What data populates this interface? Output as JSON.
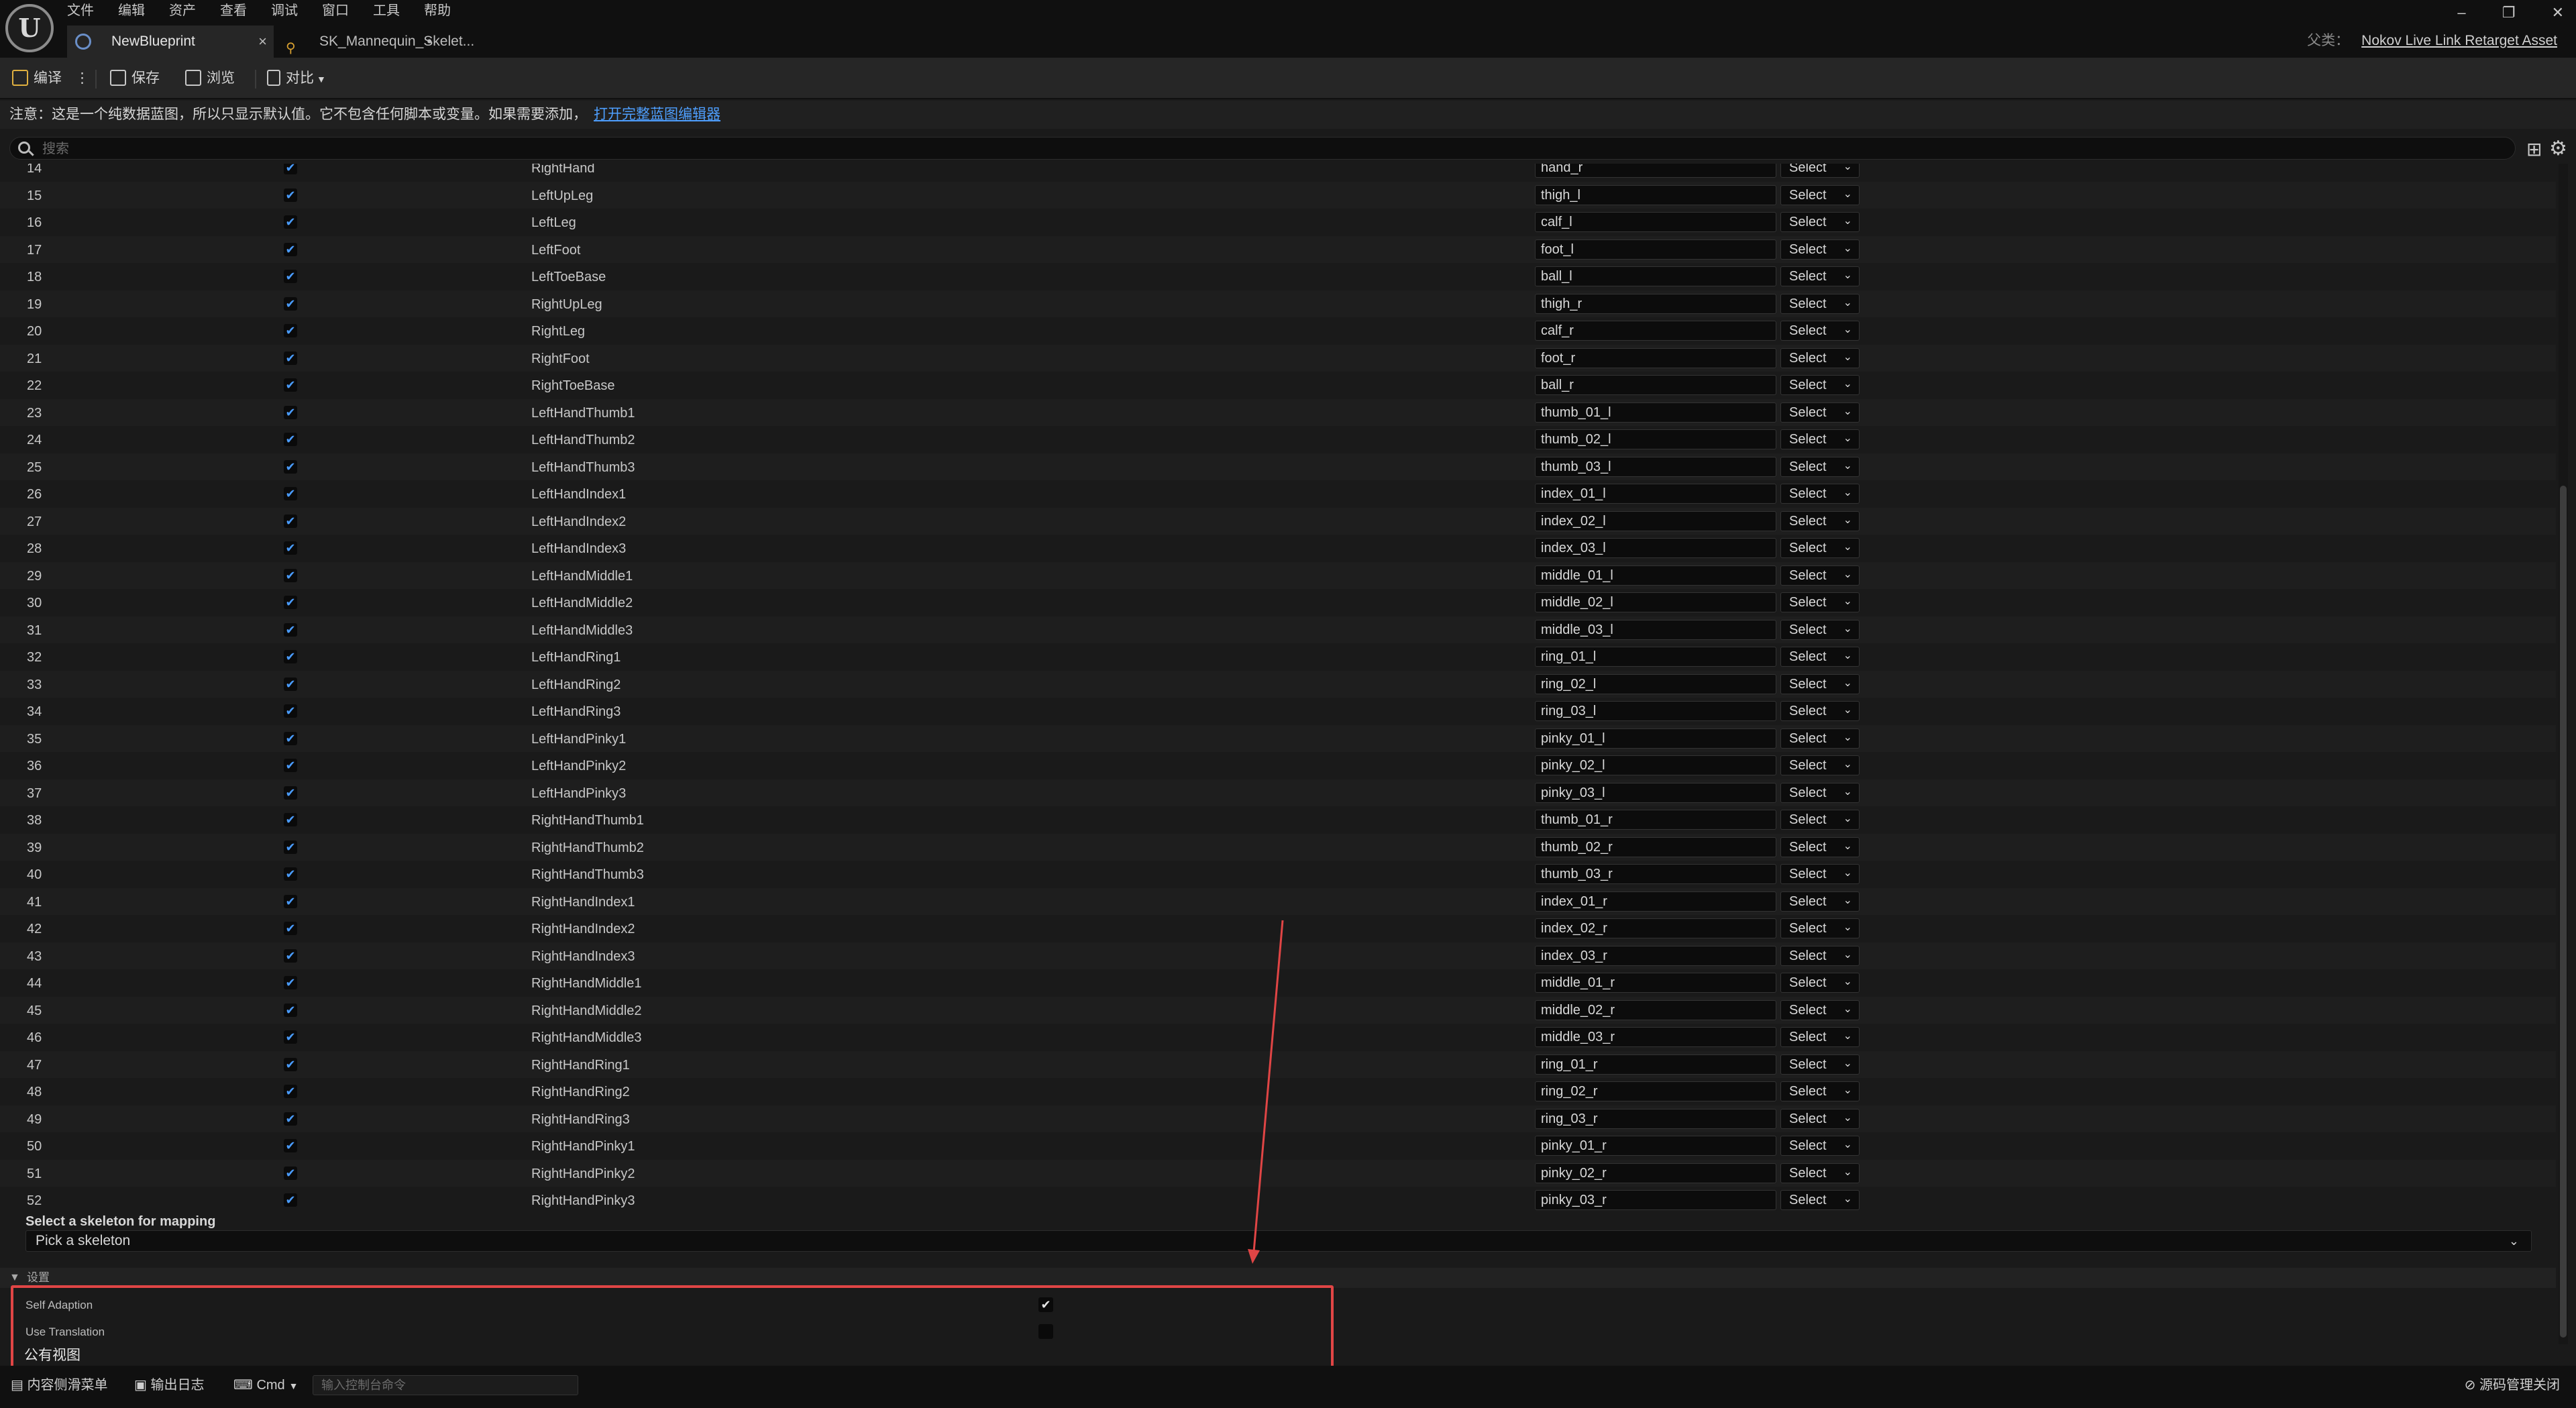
{
  "menu": [
    "文件",
    "编辑",
    "资产",
    "查看",
    "调试",
    "窗口",
    "工具",
    "帮助"
  ],
  "tabs": [
    {
      "label": "NewBlueprint",
      "close": "×"
    },
    {
      "label": "SK_Mannequin_Skelet...",
      "close": "•"
    }
  ],
  "window_controls": {
    "minimize": "–",
    "restore": "❐",
    "close": "✕"
  },
  "parent": {
    "label": "父类：",
    "value": "Nokov Live Link Retarget Asset"
  },
  "toolbar": {
    "compile": "编译",
    "more": "⋮",
    "save": "保存",
    "browse": "浏览",
    "diff": "对比"
  },
  "notice": {
    "text": "注意：这是一个纯数据蓝图，所以只显示默认值。它不包含任何脚本或变量。如果需要添加，",
    "link": "打开完整蓝图编辑器"
  },
  "search": {
    "placeholder": "搜索"
  },
  "rows": [
    {
      "index": "14",
      "name": "RightHand",
      "bone": "hand_r",
      "select": "Select"
    },
    {
      "index": "15",
      "name": "LeftUpLeg",
      "bone": "thigh_l",
      "select": "Select"
    },
    {
      "index": "16",
      "name": "LeftLeg",
      "bone": "calf_l",
      "select": "Select"
    },
    {
      "index": "17",
      "name": "LeftFoot",
      "bone": "foot_l",
      "select": "Select"
    },
    {
      "index": "18",
      "name": "LeftToeBase",
      "bone": "ball_l",
      "select": "Select"
    },
    {
      "index": "19",
      "name": "RightUpLeg",
      "bone": "thigh_r",
      "select": "Select"
    },
    {
      "index": "20",
      "name": "RightLeg",
      "bone": "calf_r",
      "select": "Select"
    },
    {
      "index": "21",
      "name": "RightFoot",
      "bone": "foot_r",
      "select": "Select"
    },
    {
      "index": "22",
      "name": "RightToeBase",
      "bone": "ball_r",
      "select": "Select"
    },
    {
      "index": "23",
      "name": "LeftHandThumb1",
      "bone": "thumb_01_l",
      "select": "Select"
    },
    {
      "index": "24",
      "name": "LeftHandThumb2",
      "bone": "thumb_02_l",
      "select": "Select"
    },
    {
      "index": "25",
      "name": "LeftHandThumb3",
      "bone": "thumb_03_l",
      "select": "Select"
    },
    {
      "index": "26",
      "name": "LeftHandIndex1",
      "bone": "index_01_l",
      "select": "Select"
    },
    {
      "index": "27",
      "name": "LeftHandIndex2",
      "bone": "index_02_l",
      "select": "Select"
    },
    {
      "index": "28",
      "name": "LeftHandIndex3",
      "bone": "index_03_l",
      "select": "Select"
    },
    {
      "index": "29",
      "name": "LeftHandMiddle1",
      "bone": "middle_01_l",
      "select": "Select"
    },
    {
      "index": "30",
      "name": "LeftHandMiddle2",
      "bone": "middle_02_l",
      "select": "Select"
    },
    {
      "index": "31",
      "name": "LeftHandMiddle3",
      "bone": "middle_03_l",
      "select": "Select"
    },
    {
      "index": "32",
      "name": "LeftHandRing1",
      "bone": "ring_01_l",
      "select": "Select"
    },
    {
      "index": "33",
      "name": "LeftHandRing2",
      "bone": "ring_02_l",
      "select": "Select"
    },
    {
      "index": "34",
      "name": "LeftHandRing3",
      "bone": "ring_03_l",
      "select": "Select"
    },
    {
      "index": "35",
      "name": "LeftHandPinky1",
      "bone": "pinky_01_l",
      "select": "Select"
    },
    {
      "index": "36",
      "name": "LeftHandPinky2",
      "bone": "pinky_02_l",
      "select": "Select"
    },
    {
      "index": "37",
      "name": "LeftHandPinky3",
      "bone": "pinky_03_l",
      "select": "Select"
    },
    {
      "index": "38",
      "name": "RightHandThumb1",
      "bone": "thumb_01_r",
      "select": "Select"
    },
    {
      "index": "39",
      "name": "RightHandThumb2",
      "bone": "thumb_02_r",
      "select": "Select"
    },
    {
      "index": "40",
      "name": "RightHandThumb3",
      "bone": "thumb_03_r",
      "select": "Select"
    },
    {
      "index": "41",
      "name": "RightHandIndex1",
      "bone": "index_01_r",
      "select": "Select"
    },
    {
      "index": "42",
      "name": "RightHandIndex2",
      "bone": "index_02_r",
      "select": "Select"
    },
    {
      "index": "43",
      "name": "RightHandIndex3",
      "bone": "index_03_r",
      "select": "Select"
    },
    {
      "index": "44",
      "name": "RightHandMiddle1",
      "bone": "middle_01_r",
      "select": "Select"
    },
    {
      "index": "45",
      "name": "RightHandMiddle2",
      "bone": "middle_02_r",
      "select": "Select"
    },
    {
      "index": "46",
      "name": "RightHandMiddle3",
      "bone": "middle_03_r",
      "select": "Select"
    },
    {
      "index": "47",
      "name": "RightHandRing1",
      "bone": "ring_01_r",
      "select": "Select"
    },
    {
      "index": "48",
      "name": "RightHandRing2",
      "bone": "ring_02_r",
      "select": "Select"
    },
    {
      "index": "49",
      "name": "RightHandRing3",
      "bone": "ring_03_r",
      "select": "Select"
    },
    {
      "index": "50",
      "name": "RightHandPinky1",
      "bone": "pinky_01_r",
      "select": "Select"
    },
    {
      "index": "51",
      "name": "RightHandPinky2",
      "bone": "pinky_02_r",
      "select": "Select"
    },
    {
      "index": "52",
      "name": "RightHandPinky3",
      "bone": "pinky_03_r",
      "select": "Select"
    }
  ],
  "skeleton": {
    "label": "Select a skeleton for mapping",
    "value": "Pick a skeleton"
  },
  "settings": {
    "header": "设置",
    "self_adaption": {
      "label": "Self Adaption",
      "checked": true
    },
    "use_translation": {
      "label": "Use Translation",
      "checked": false
    },
    "public_view": "公有视图"
  },
  "statusbar": {
    "content_drawer": "内容侧滑菜单",
    "output_log": "输出日志",
    "cmd": "Cmd",
    "cmd_placeholder": "输入控制台命令",
    "source_control": "源码管理关闭"
  },
  "colors": {
    "highlight": "#e04545",
    "accent": "#4a9cff",
    "link": "#4e9fff"
  }
}
